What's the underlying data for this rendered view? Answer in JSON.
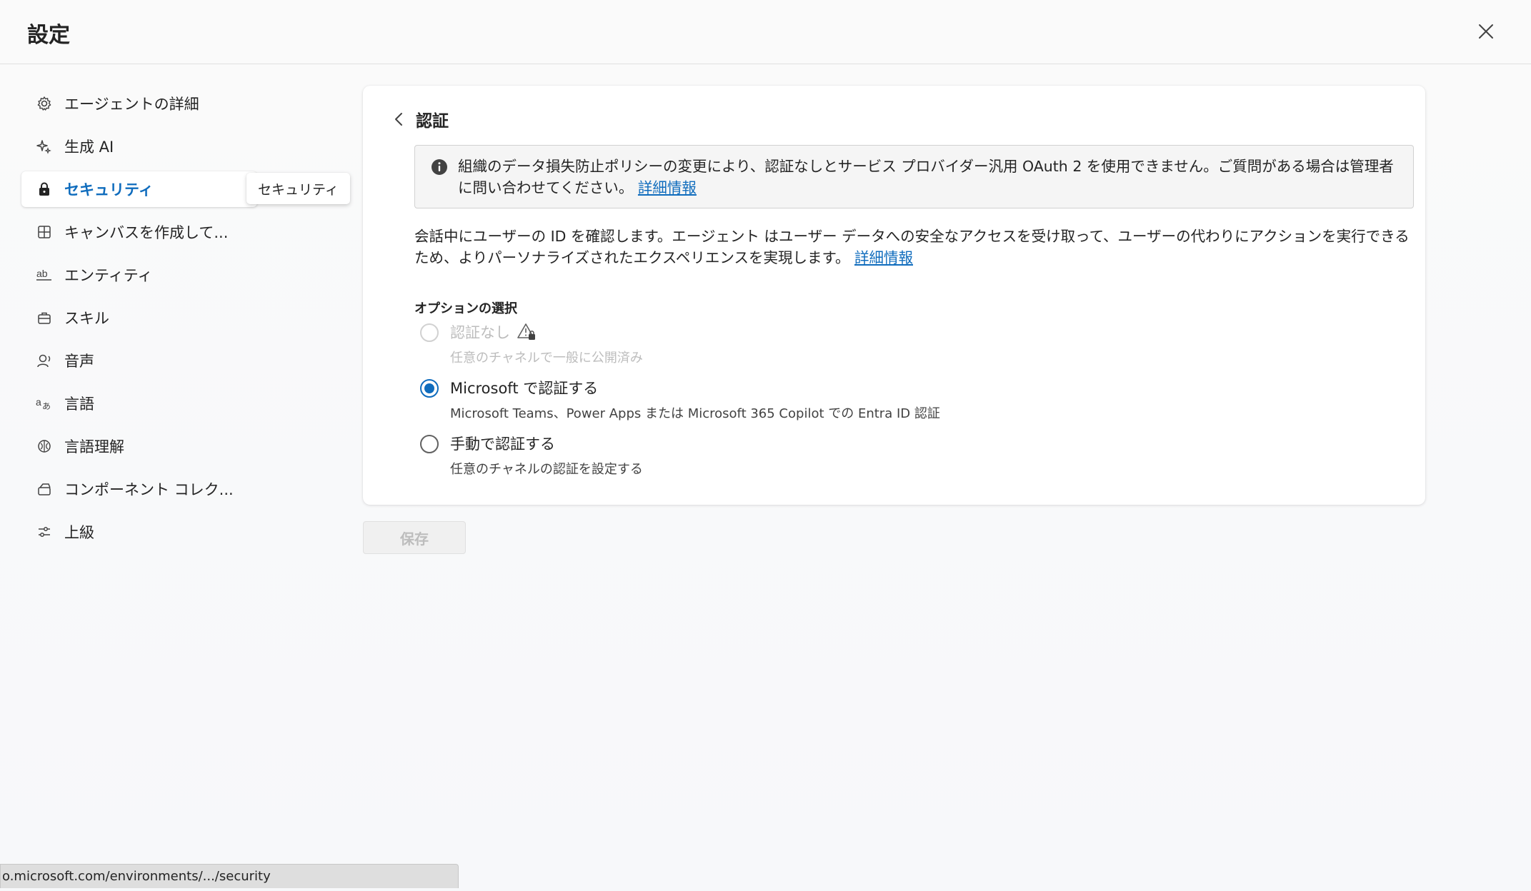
{
  "header": {
    "title": "設定",
    "close_icon": "close-icon"
  },
  "sidebar": {
    "items": [
      {
        "label": "エージェントの詳細",
        "icon": "gear-icon"
      },
      {
        "label": "生成 AI",
        "icon": "sparkle-icon"
      },
      {
        "label": "セキュリティ",
        "icon": "lock-icon",
        "active": true
      },
      {
        "label": "キャンバスを作成して...",
        "icon": "grid-icon"
      },
      {
        "label": "エンティティ",
        "icon": "abc-icon"
      },
      {
        "label": "スキル",
        "icon": "briefcase-icon"
      },
      {
        "label": "音声",
        "icon": "voice-icon"
      },
      {
        "label": "言語",
        "icon": "translate-icon"
      },
      {
        "label": "言語理解",
        "icon": "brain-icon"
      },
      {
        "label": "コンポーネント コレク...",
        "icon": "package-icon"
      },
      {
        "label": "上級",
        "icon": "settings-sliders-icon"
      }
    ],
    "tooltip": "セキュリティ"
  },
  "card": {
    "title": "認証",
    "banner": {
      "text": "組織のデータ損失防止ポリシーの変更により、認証なしとサービス プロバイダー汎用 OAuth 2 を使用できません。ご質問がある場合は管理者に問い合わせてください。",
      "link": "詳細情報"
    },
    "description": {
      "text": "会話中にユーザーの ID を確認します。エージェント はユーザー データへの安全なアクセスを受け取って、ユーザーの代わりにアクションを実行できるため、よりパーソナライズされたエクスペリエンスを実現します。",
      "link": "詳細情報"
    },
    "options_label": "オプションの選択",
    "options": [
      {
        "title": "認証なし",
        "subtitle": "任意のチャネルで一般に公開済み",
        "disabled": true,
        "checked": false
      },
      {
        "title": "Microsoft で認証する",
        "subtitle": "Microsoft Teams、Power Apps または Microsoft 365 Copilot での Entra ID 認証",
        "disabled": false,
        "checked": true
      },
      {
        "title": "手動で認証する",
        "subtitle": "任意のチャネルの認証を設定する",
        "disabled": false,
        "checked": false
      }
    ]
  },
  "save_label": "保存",
  "status_url": "o.microsoft.com/environments/.../security",
  "colors": {
    "accent": "#0f6cbd",
    "disabled": "#bdbdbd"
  }
}
